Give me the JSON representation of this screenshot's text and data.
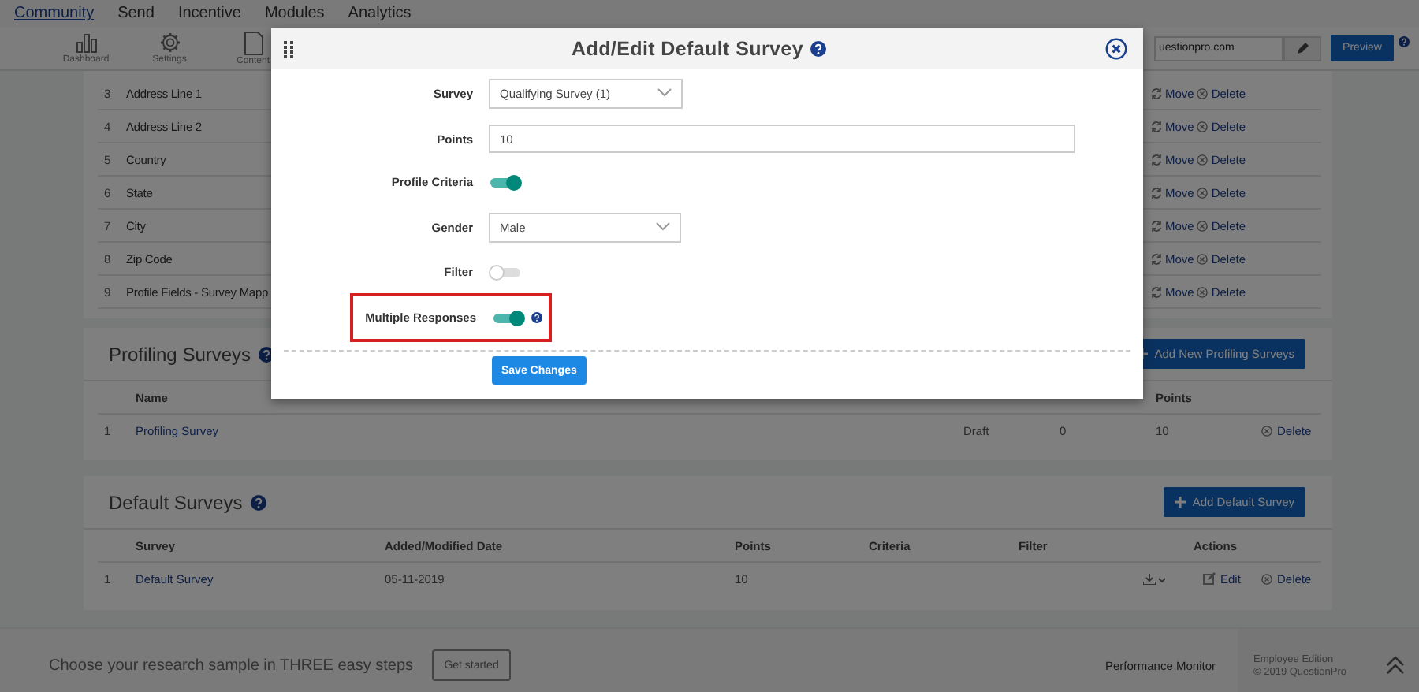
{
  "nav": [
    {
      "label": "Community",
      "selected": true
    },
    {
      "label": "Send",
      "selected": false
    },
    {
      "label": "Incentive",
      "selected": false
    },
    {
      "label": "Modules",
      "selected": false
    },
    {
      "label": "Analytics",
      "selected": false
    }
  ],
  "toolbar": {
    "items": [
      {
        "kind": "dashboard",
        "label": "Dashboard"
      },
      {
        "kind": "settings",
        "label": "Settings"
      },
      {
        "kind": "content",
        "label": "Content"
      }
    ],
    "url_field": {
      "value": "uestionpro.com"
    },
    "preview_button": "Preview"
  },
  "fields_list": {
    "rows": [
      {
        "number": "3",
        "name": "Address Line 1",
        "move": "Move",
        "delete": "Delete"
      },
      {
        "number": "4",
        "name": "Address Line 2",
        "move": "Move",
        "delete": "Delete"
      },
      {
        "number": "5",
        "name": "Country",
        "move": "Move",
        "delete": "Delete"
      },
      {
        "number": "6",
        "name": "State",
        "move": "Move",
        "delete": "Delete"
      },
      {
        "number": "7",
        "name": "City",
        "move": "Move",
        "delete": "Delete"
      },
      {
        "number": "8",
        "name": "Zip Code",
        "move": "Move",
        "delete": "Delete"
      },
      {
        "number": "9",
        "name": "Profile Fields - Survey Mapp",
        "move": "Move",
        "delete": "Delete"
      }
    ]
  },
  "profiling_surveys": {
    "title": "Profiling Surveys",
    "add_button": "Add New Profiling Surveys",
    "columns": [
      "Name",
      "Points"
    ],
    "rows": [
      {
        "number": "1",
        "name": "Profiling Survey",
        "status": "Draft",
        "questions": "0",
        "points": "10",
        "delete": "Delete"
      }
    ]
  },
  "default_surveys": {
    "title": "Default Surveys",
    "add_button": "Add Default Survey",
    "columns": [
      "Survey",
      "Added/Modified Date",
      "Points",
      "Criteria",
      "Filter",
      "Actions"
    ],
    "rows": [
      {
        "number": "1",
        "survey": "Default Survey",
        "date": "05-11-2019",
        "points": "10",
        "edit": "Edit",
        "delete": "Delete"
      }
    ]
  },
  "footer": {
    "promo": "Choose your research sample in THREE easy steps",
    "get_started": "Get started",
    "performance_monitor": "Performance Monitor",
    "edition": "Employee Edition",
    "copyright": "© 2019 QuestionPro"
  },
  "modal": {
    "title": "Add/Edit Default Survey",
    "fields": [
      {
        "kind": "select",
        "label": "Survey",
        "value": "Qualifying Survey (1)",
        "help": false,
        "highlighted": false
      },
      {
        "kind": "input",
        "label": "Points",
        "value": "10",
        "help": false,
        "highlighted": false
      },
      {
        "kind": "toggle",
        "label": "Profile Criteria",
        "on": true,
        "help": false,
        "highlighted": false
      },
      {
        "kind": "select",
        "label": "Gender",
        "value": "Male",
        "help": false,
        "highlighted": false
      },
      {
        "kind": "toggle",
        "label": "Filter",
        "on": false,
        "help": false,
        "highlighted": false
      },
      {
        "kind": "toggle",
        "label": "Multiple Responses",
        "on": true,
        "help": true,
        "highlighted": true
      }
    ],
    "save_button": "Save Changes"
  }
}
